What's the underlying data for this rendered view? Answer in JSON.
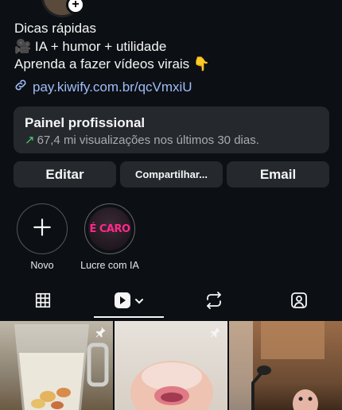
{
  "profile": {
    "bio_lines": [
      "Dicas rápidas",
      "🎥 IA + humor + utilidade",
      "Aprenda a fazer vídeos virais 👇"
    ],
    "link": "pay.kiwify.com.br/qcVmxiU"
  },
  "pro_dashboard": {
    "title": "Painel profissional",
    "subtitle": "67,4 mi visualizações nos últimos 30 dias."
  },
  "buttons": {
    "edit": "Editar",
    "share": "Compartilhar...",
    "email": "Email"
  },
  "highlights": [
    {
      "label": "Novo"
    },
    {
      "label": "Lucre com IA",
      "cover_text": "É CARO"
    }
  ],
  "tabs": [
    {
      "icon": "grid-icon"
    },
    {
      "icon": "reels-icon",
      "active": true
    },
    {
      "icon": "repost-icon"
    },
    {
      "icon": "tagged-icon"
    }
  ],
  "colors": {
    "background": "#0c1014",
    "card": "#25292e",
    "link": "#9fbbf7",
    "trend_up": "#4ec96b"
  }
}
